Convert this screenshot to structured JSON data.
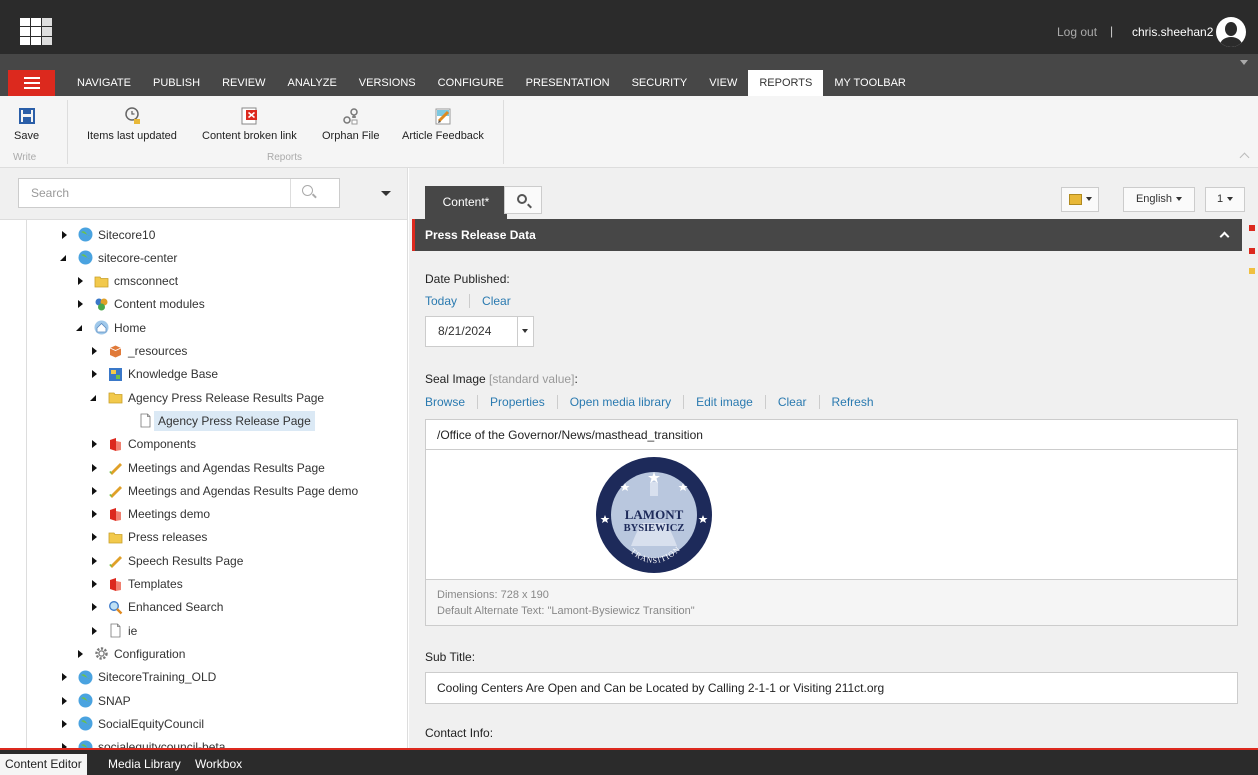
{
  "topbar": {
    "logout": "Log out",
    "separator": "|",
    "username": "chris.sheehan2"
  },
  "menu": {
    "tabs": [
      "NAVIGATE",
      "PUBLISH",
      "REVIEW",
      "ANALYZE",
      "VERSIONS",
      "CONFIGURE",
      "PRESENTATION",
      "SECURITY",
      "VIEW",
      "REPORTS",
      "MY TOOLBAR"
    ],
    "active": "REPORTS"
  },
  "ribbon": {
    "save": "Save",
    "write_group": "Write",
    "items_last_updated": "Items last updated",
    "content_broken_link": "Content broken link",
    "orphan_file": "Orphan File",
    "article_feedback": "Article Feedback",
    "reports_group": "Reports"
  },
  "search": {
    "placeholder": "Search"
  },
  "tree": [
    {
      "label": "Sitecore10",
      "level": 1,
      "state": "closed",
      "icon": "globe-icon"
    },
    {
      "label": "sitecore-center",
      "level": 1,
      "state": "open",
      "icon": "globe-icon"
    },
    {
      "label": "cmsconnect",
      "level": 2,
      "state": "closed",
      "icon": "folder-icon"
    },
    {
      "label": "Content modules",
      "level": 2,
      "state": "closed",
      "icon": "modules-icon"
    },
    {
      "label": "Home",
      "level": 2,
      "state": "open",
      "icon": "home-icon"
    },
    {
      "label": "_resources",
      "level": 3,
      "state": "closed",
      "icon": "box-icon"
    },
    {
      "label": "Knowledge Base",
      "level": 3,
      "state": "closed",
      "icon": "kb-icon"
    },
    {
      "label": "Agency Press Release Results Page",
      "level": 3,
      "state": "open",
      "icon": "folder-icon"
    },
    {
      "label": "Agency Press Release Page",
      "level": 4,
      "state": "none",
      "icon": "document-icon",
      "selected": true
    },
    {
      "label": "Components",
      "level": 3,
      "state": "closed",
      "icon": "components-icon"
    },
    {
      "label": "Meetings and Agendas Results Page",
      "level": 3,
      "state": "closed",
      "icon": "pencil-icon"
    },
    {
      "label": "Meetings and Agendas Results Page demo",
      "level": 3,
      "state": "closed",
      "icon": "pencil-icon"
    },
    {
      "label": "Meetings demo",
      "level": 3,
      "state": "closed",
      "icon": "components-icon"
    },
    {
      "label": "Press releases",
      "level": 3,
      "state": "closed",
      "icon": "folder-icon"
    },
    {
      "label": "Speech Results Page",
      "level": 3,
      "state": "closed",
      "icon": "pencil-icon"
    },
    {
      "label": "Templates",
      "level": 3,
      "state": "closed",
      "icon": "components-icon"
    },
    {
      "label": "Enhanced Search",
      "level": 3,
      "state": "closed",
      "icon": "magnifier-icon"
    },
    {
      "label": "ie",
      "level": 3,
      "state": "closed",
      "icon": "document-icon"
    },
    {
      "label": "Configuration",
      "level": 2,
      "state": "closed",
      "icon": "gear-icon"
    },
    {
      "label": "SitecoreTraining_OLD",
      "level": 1,
      "state": "closed",
      "icon": "globe-icon"
    },
    {
      "label": "SNAP",
      "level": 1,
      "state": "closed",
      "icon": "globe-icon"
    },
    {
      "label": "SocialEquityCouncil",
      "level": 1,
      "state": "closed",
      "icon": "globe-icon"
    },
    {
      "label": "socialequitycouncil-beta",
      "level": 1,
      "state": "closed",
      "icon": "globe-icon"
    }
  ],
  "editor": {
    "tab_content": "Content*",
    "language": "English",
    "version": "1",
    "section_title": "Press Release Data",
    "date_label": "Date Published:",
    "date_links": [
      "Today",
      "Clear"
    ],
    "date_value": "8/21/2024",
    "seal_label": "Seal Image",
    "seal_std": "[standard value]",
    "seal_colon": ":",
    "seal_links": [
      "Browse",
      "Properties",
      "Open media library",
      "Edit image",
      "Clear",
      "Refresh"
    ],
    "seal_path": "/Office of the Governor/News/masthead_transition",
    "seal_text_top": "LAMONT",
    "seal_text_bottom": "BYSIEWICZ",
    "seal_text_arc": "TRANSITION",
    "dimensions": "Dimensions: 728 x 190",
    "alt_text": "Default Alternate Text: \"Lamont-Bysiewicz Transition\"",
    "subtitle_label": "Sub Title:",
    "subtitle_value": "Cooling Centers Are Open and Can be Located by Calling 2-1-1 or Visiting 211ct.org",
    "contact_label": "Contact Info:"
  },
  "bottom": {
    "tabs": [
      "Content Editor",
      "Media Library",
      "Workbox"
    ]
  },
  "colors": {
    "accent": "#dc291e",
    "dark": "#2b2b2b",
    "menu": "#474747",
    "link": "#2a7ab0",
    "seal_navy": "#1d2a5a"
  }
}
